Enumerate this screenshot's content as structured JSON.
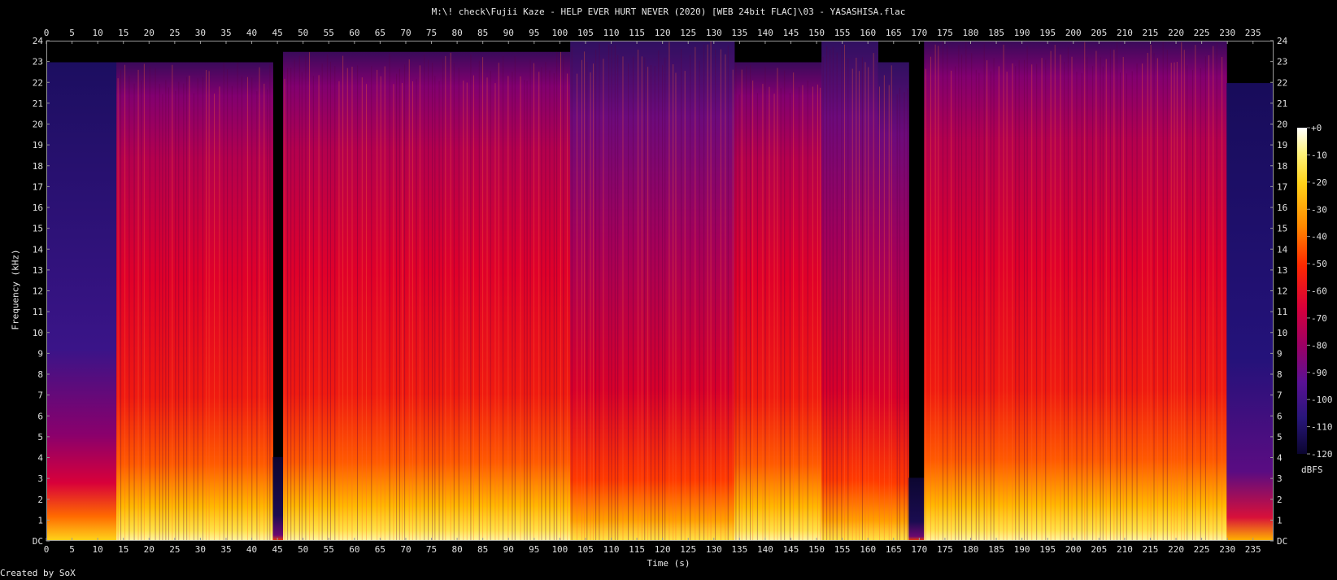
{
  "title": "M:\\! check\\Fujii Kaze - HELP EVER HURT NEVER (2020) [WEB 24bit FLAC]\\03 - YASASHISA.flac",
  "credit": "Created by SoX",
  "chart_data": {
    "type": "heatmap",
    "title": "M:\\! check\\Fujii Kaze - HELP EVER HURT NEVER (2020) [WEB 24bit FLAC]\\03 - YASASHISA.flac",
    "xlabel": "Time (s)",
    "ylabel": "Frequency (kHz)",
    "colorbar_label": "dBFS",
    "xlim": [
      0,
      239
    ],
    "ylim": [
      0,
      24
    ],
    "x_ticks": [
      0,
      5,
      10,
      15,
      20,
      25,
      30,
      35,
      40,
      45,
      50,
      55,
      60,
      65,
      70,
      75,
      80,
      85,
      90,
      95,
      100,
      105,
      110,
      115,
      120,
      125,
      130,
      135,
      140,
      145,
      150,
      155,
      160,
      165,
      170,
      175,
      180,
      185,
      190,
      195,
      200,
      205,
      210,
      215,
      220,
      225,
      230,
      235
    ],
    "y_ticks": [
      "DC",
      "1",
      "2",
      "3",
      "4",
      "5",
      "6",
      "7",
      "8",
      "9",
      "10",
      "11",
      "12",
      "13",
      "14",
      "15",
      "16",
      "17",
      "18",
      "19",
      "20",
      "21",
      "22",
      "23",
      "24"
    ],
    "colorbar_ticks": [
      "+0",
      "-10",
      "-20",
      "-30",
      "-40",
      "-50",
      "-60",
      "-70",
      "-80",
      "-90",
      "-100",
      "-110",
      "-120"
    ],
    "segments": [
      {
        "start": 0,
        "end": 13.5,
        "cutoff_khz": 23
      },
      {
        "start": 13.5,
        "end": 44,
        "cutoff_khz": 23
      },
      {
        "start": 44,
        "end": 46,
        "cutoff_khz": 4
      },
      {
        "start": 46,
        "end": 102,
        "cutoff_khz": 23.5
      },
      {
        "start": 102,
        "end": 134,
        "cutoff_khz": 24
      },
      {
        "start": 134,
        "end": 151,
        "cutoff_khz": 23
      },
      {
        "start": 151,
        "end": 162,
        "cutoff_khz": 24
      },
      {
        "start": 162,
        "end": 168,
        "cutoff_khz": 23
      },
      {
        "start": 168,
        "end": 171,
        "cutoff_khz": 3
      },
      {
        "start": 171,
        "end": 230,
        "cutoff_khz": 24
      },
      {
        "start": 230,
        "end": 239,
        "cutoff_khz": 22
      }
    ]
  }
}
